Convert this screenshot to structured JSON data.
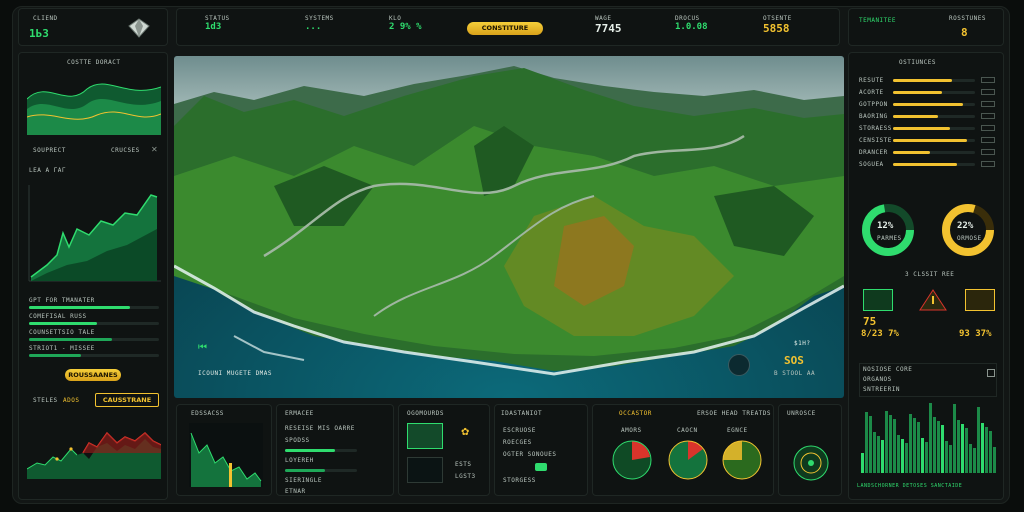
{
  "top_bar": {
    "left_label": "CLIEND",
    "left_value": "1ЬЗ",
    "metrics": [
      {
        "label": "STATUS",
        "value": "1d3"
      },
      {
        "label": "SYSTEMS",
        "value": "..."
      },
      {
        "label": "KLO",
        "value": "2 9% %"
      },
      {
        "label": "WAGE",
        "value": "7745"
      },
      {
        "label": "DROCUS",
        "value": "1.0.08"
      },
      {
        "label": "OTSENTE",
        "value": "5858"
      }
    ],
    "center_button": "CONSTITURE",
    "right_left_label": "TEMANITEE",
    "right_right_label": "ROSSTUNES",
    "right_right_value": "8"
  },
  "left_sidebar": {
    "chart_title": "COSTTE DORACT",
    "tab_a": "SOUPRECT",
    "tab_b": "CRUCSES",
    "small_row": "LEA A ГАГ",
    "bar_rows": [
      {
        "label": "GPT FOR TMANATER",
        "value": 0.78,
        "color": "#2fdc6e"
      },
      {
        "label": "COMEFISAL RUSS",
        "value": 0.52,
        "color": "#2fdc6e"
      },
      {
        "label": "COUNSETTSIO TALE",
        "value": 0.64,
        "color": "#1fa758"
      },
      {
        "label": "STRIOT1 - MISSEE",
        "value": 0.4,
        "color": "#1fa758"
      }
    ],
    "pill_label": "ROUSSAANES",
    "sub_left": "STELES",
    "sub_mid": "ADOS",
    "sub_button": "CAUSSTRANE"
  },
  "map": {
    "caption": "ICOUNI MUGETE DMAS",
    "right_small": "$1H?",
    "right_code": "SOS",
    "right_sub": "B STOOL AA"
  },
  "bottom_panels": {
    "p1_title": "EDSSACSS",
    "p2_title": "ERMACEE",
    "p2_rows": [
      "RESEISE MIS OARRE",
      "SPODSS",
      "LOYEREH",
      "SIERINGLE"
    ],
    "p2_footer": "ETNAR",
    "p3_title": "OGOMOURDS",
    "p3_value": "ESTS",
    "p3_sub": "LGST3",
    "p4_title": "IDASTANIOT",
    "p4_rows": [
      "ESCRUOSE",
      "ROECGES",
      "OGTER SONOUES",
      "STORGESS"
    ],
    "p5_title": "OCCASTOR",
    "p5_sub": "ERSOE HEAD TREATDS",
    "p5_labels": [
      "AMORS",
      "CAOCN",
      "EGNCE"
    ],
    "p6_title": "UNROSCE"
  },
  "right_sidebar": {
    "title": "OSTIUNCES",
    "rows": [
      {
        "label": "RESUTE",
        "value": 0.72
      },
      {
        "label": "ACORTE",
        "value": 0.6
      },
      {
        "label": "GOTPPON",
        "value": 0.85
      },
      {
        "label": "BAORING",
        "value": 0.55
      },
      {
        "label": "STORAESS",
        "value": 0.7
      },
      {
        "label": "CENSISTE",
        "value": 0.9
      },
      {
        "label": "DRANCER",
        "value": 0.45
      },
      {
        "label": "SOGUEA",
        "value": 0.78
      }
    ],
    "donut_left_value": "12%",
    "donut_left_label": "PARMES",
    "donut_right_value": "22%",
    "donut_right_label": "ORMOSE",
    "section_title": "3 CLSSIT REE",
    "stat_a": "75",
    "stat_b": "8/23 7%",
    "stat_c": "93 37%",
    "list_rows": [
      "NOSIOSE CORE",
      "ORGANOS",
      "SNTREERIN"
    ],
    "footer": "LANDSCHORNER DETOSES SANCTAIDE"
  },
  "colors": {
    "accent_green": "#2fdc6e",
    "accent_yellow": "#f2c230",
    "alert_red": "#d9342b"
  }
}
